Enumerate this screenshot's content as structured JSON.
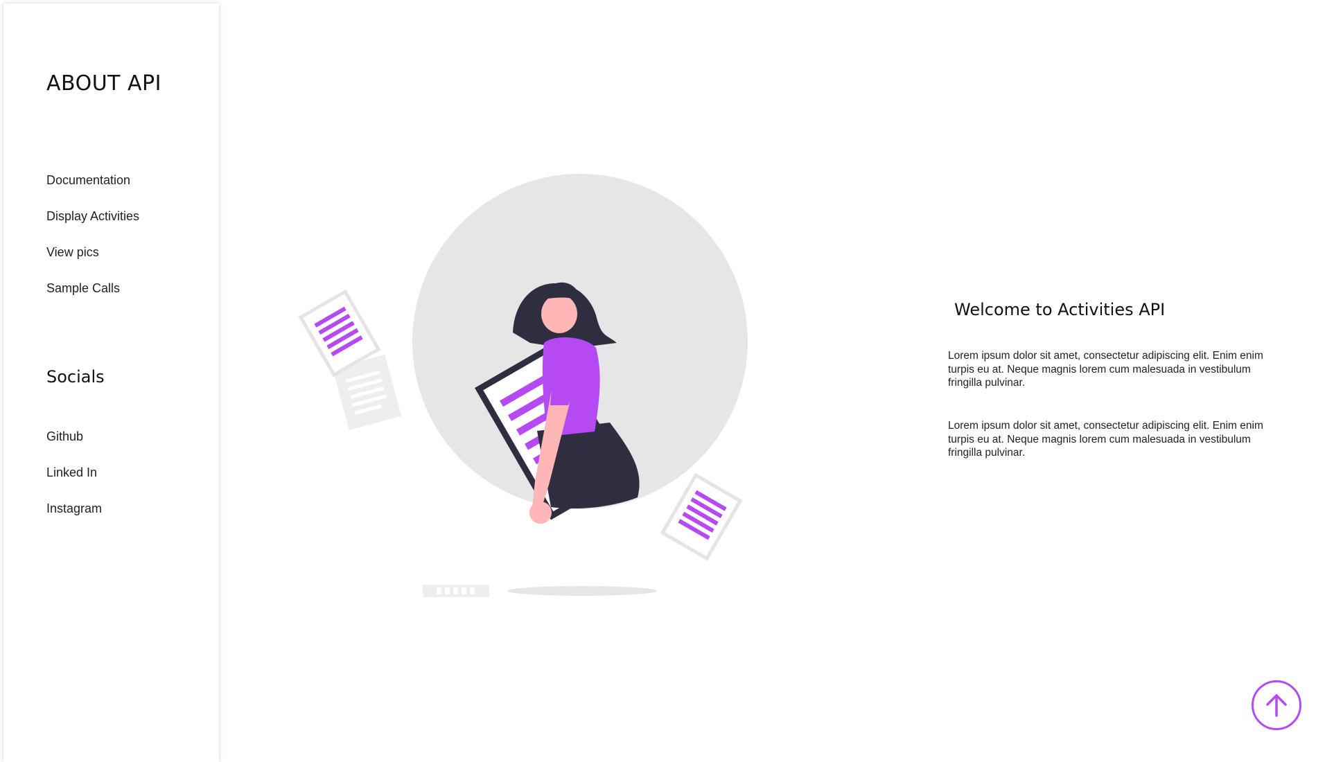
{
  "sidebar": {
    "brand": "ABOUT API",
    "nav": [
      {
        "label": "Documentation"
      },
      {
        "label": "Display Activities"
      },
      {
        "label": "View pics"
      },
      {
        "label": "Sample Calls"
      }
    ],
    "socials_title": "Socials",
    "socials": [
      {
        "label": "Github"
      },
      {
        "label": "Linked In"
      },
      {
        "label": "Instagram"
      }
    ]
  },
  "main": {
    "welcome": "Welcome to Activities API",
    "paragraphs": [
      "Lorem ipsum dolor sit amet, consectetur adipiscing elit. Enim enim turpis eu at. Neque magnis lorem cum malesuada in vestibulum fringilla pulvinar.",
      "Lorem ipsum dolor sit amet, consectetur adipiscing elit. Enim enim turpis eu at. Neque magnis lorem cum malesuada in vestibulum fringilla pulvinar."
    ]
  },
  "icons": {
    "scroll_top": "arrow-up-circle-icon",
    "illustration": "woman-with-document-illustration"
  },
  "colors": {
    "accent": "#b64af2",
    "dark": "#2f2e41",
    "skin": "#ffb6b6",
    "circle": "#e6e6e6"
  }
}
